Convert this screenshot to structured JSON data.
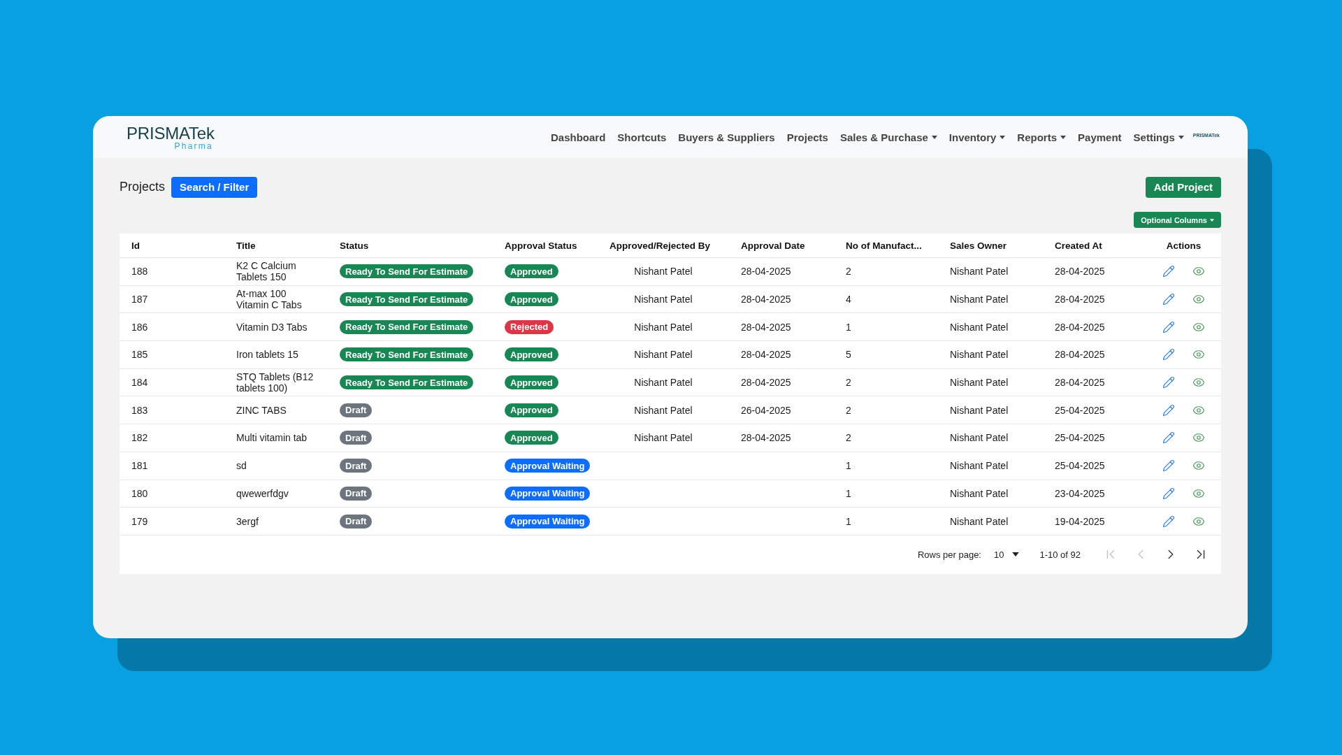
{
  "logo": {
    "name": "PRISMATek",
    "tagline": "Pharma"
  },
  "nav": {
    "items": [
      {
        "label": "Dashboard",
        "kind": "link"
      },
      {
        "label": "Shortcuts",
        "kind": "link"
      },
      {
        "label": "Buyers & Suppliers",
        "kind": "link"
      },
      {
        "label": "Projects",
        "kind": "link"
      },
      {
        "label": "Sales & Purchase",
        "kind": "dropdown"
      },
      {
        "label": "Inventory",
        "kind": "dropdown"
      },
      {
        "label": "Reports",
        "kind": "dropdown"
      },
      {
        "label": "Payment",
        "kind": "link"
      },
      {
        "label": "Settings",
        "kind": "dropdown"
      }
    ],
    "brand_mark": "PRISMATek"
  },
  "page": {
    "title": "Projects",
    "search_button": "Search / Filter",
    "add_button": "Add Project",
    "columns_button": "Optional Columns"
  },
  "table": {
    "columns": [
      "Id",
      "Title",
      "Status",
      "Approval Status",
      "Approved/Rejected By",
      "Approval Date",
      "No of Manufact...",
      "Sales Owner",
      "Created At",
      "Actions"
    ],
    "rows": [
      {
        "id": "188",
        "title": "K2 C Calcium Tablets 150",
        "status": {
          "label": "Ready To Send For Estimate",
          "color": "#198754"
        },
        "approval_status": {
          "label": "Approved",
          "color": "#198754"
        },
        "approved_by": "Nishant Patel",
        "approval_date": "28-04-2025",
        "manufacturers": "2",
        "sales_owner": "Nishant Patel",
        "created_at": "28-04-2025"
      },
      {
        "id": "187",
        "title": "At-max 100 Vitamin C Tabs",
        "status": {
          "label": "Ready To Send For Estimate",
          "color": "#198754"
        },
        "approval_status": {
          "label": "Approved",
          "color": "#198754"
        },
        "approved_by": "Nishant Patel",
        "approval_date": "28-04-2025",
        "manufacturers": "4",
        "sales_owner": "Nishant Patel",
        "created_at": "28-04-2025"
      },
      {
        "id": "186",
        "title": "Vitamin D3 Tabs",
        "status": {
          "label": "Ready To Send For Estimate",
          "color": "#198754"
        },
        "approval_status": {
          "label": "Rejected",
          "color": "#dc3545"
        },
        "approved_by": "Nishant Patel",
        "approval_date": "28-04-2025",
        "manufacturers": "1",
        "sales_owner": "Nishant Patel",
        "created_at": "28-04-2025"
      },
      {
        "id": "185",
        "title": "Iron tablets 15",
        "status": {
          "label": "Ready To Send For Estimate",
          "color": "#198754"
        },
        "approval_status": {
          "label": "Approved",
          "color": "#198754"
        },
        "approved_by": "Nishant Patel",
        "approval_date": "28-04-2025",
        "manufacturers": "5",
        "sales_owner": "Nishant Patel",
        "created_at": "28-04-2025"
      },
      {
        "id": "184",
        "title": "STQ Tablets (B12 tablets 100)",
        "status": {
          "label": "Ready To Send For Estimate",
          "color": "#198754"
        },
        "approval_status": {
          "label": "Approved",
          "color": "#198754"
        },
        "approved_by": "Nishant Patel",
        "approval_date": "28-04-2025",
        "manufacturers": "2",
        "sales_owner": "Nishant Patel",
        "created_at": "28-04-2025"
      },
      {
        "id": "183",
        "title": "ZINC TABS",
        "status": {
          "label": "Draft",
          "color": "#6c757d"
        },
        "approval_status": {
          "label": "Approved",
          "color": "#198754"
        },
        "approved_by": "Nishant Patel",
        "approval_date": "26-04-2025",
        "manufacturers": "2",
        "sales_owner": "Nishant Patel",
        "created_at": "25-04-2025"
      },
      {
        "id": "182",
        "title": "Multi vitamin tab",
        "status": {
          "label": "Draft",
          "color": "#6c757d"
        },
        "approval_status": {
          "label": "Approved",
          "color": "#198754"
        },
        "approved_by": "Nishant Patel",
        "approval_date": "28-04-2025",
        "manufacturers": "2",
        "sales_owner": "Nishant Patel",
        "created_at": "25-04-2025"
      },
      {
        "id": "181",
        "title": "sd",
        "status": {
          "label": "Draft",
          "color": "#6c757d"
        },
        "approval_status": {
          "label": "Approval Waiting",
          "color": "#0d6efd"
        },
        "manufacturers": "1",
        "sales_owner": "Nishant Patel",
        "created_at": "25-04-2025"
      },
      {
        "id": "180",
        "title": "qwewerfdgv",
        "status": {
          "label": "Draft",
          "color": "#6c757d"
        },
        "approval_status": {
          "label": "Approval Waiting",
          "color": "#0d6efd"
        },
        "manufacturers": "1",
        "sales_owner": "Nishant Patel",
        "created_at": "23-04-2025"
      },
      {
        "id": "179",
        "title": "3ergf",
        "status": {
          "label": "Draft",
          "color": "#6c757d"
        },
        "approval_status": {
          "label": "Approval Waiting",
          "color": "#0d6efd"
        },
        "manufacturers": "1",
        "sales_owner": "Nishant Patel",
        "created_at": "19-04-2025"
      }
    ],
    "pagination": {
      "rows_per_page_label": "Rows per page:",
      "rows_per_page": "10",
      "range": "1-10 of 92",
      "buttons": [
        {
          "kind": "first",
          "disabled": true
        },
        {
          "kind": "previous",
          "disabled": true
        },
        {
          "kind": "next",
          "disabled": false
        },
        {
          "kind": "last",
          "disabled": false
        }
      ]
    }
  }
}
